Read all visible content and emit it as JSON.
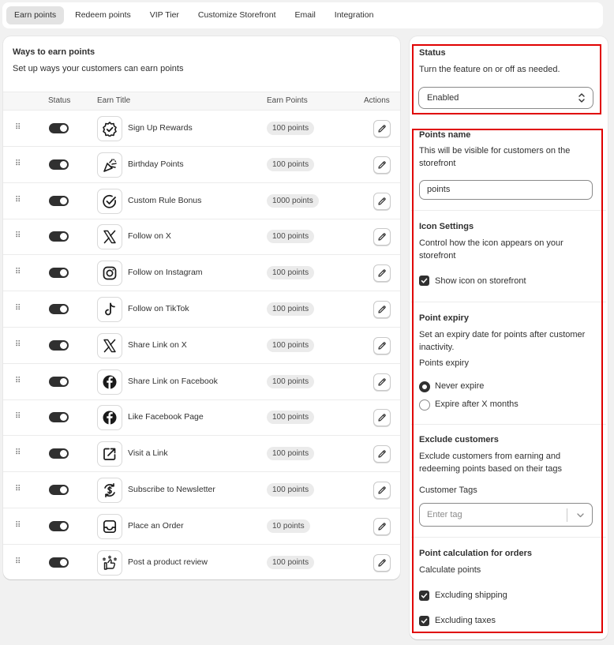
{
  "tabs": [
    {
      "label": "Earn points",
      "active": true
    },
    {
      "label": "Redeem points",
      "active": false
    },
    {
      "label": "VIP Tier",
      "active": false
    },
    {
      "label": "Customize Storefront",
      "active": false
    },
    {
      "label": "Email",
      "active": false
    },
    {
      "label": "Integration",
      "active": false
    }
  ],
  "earn": {
    "title": "Ways to earn points",
    "subtitle": "Set up ways your customers can earn points",
    "columns": {
      "status": "Status",
      "title": "Earn Title",
      "points": "Earn Points",
      "actions": "Actions"
    },
    "rows": [
      {
        "title": "Sign Up Rewards",
        "points": "100 points",
        "icon": "badge-check-icon",
        "enabled": true
      },
      {
        "title": "Birthday Points",
        "points": "100 points",
        "icon": "party-popper-icon",
        "enabled": true
      },
      {
        "title": "Custom Rule Bonus",
        "points": "1000 points",
        "icon": "check-circle-icon",
        "enabled": true
      },
      {
        "title": "Follow on X",
        "points": "100 points",
        "icon": "x-logo-icon",
        "enabled": true
      },
      {
        "title": "Follow on Instagram",
        "points": "100 points",
        "icon": "instagram-icon",
        "enabled": true
      },
      {
        "title": "Follow on TikTok",
        "points": "100 points",
        "icon": "tiktok-icon",
        "enabled": true
      },
      {
        "title": "Share Link on X",
        "points": "100 points",
        "icon": "x-logo-icon",
        "enabled": true
      },
      {
        "title": "Share Link on Facebook",
        "points": "100 points",
        "icon": "facebook-icon",
        "enabled": true
      },
      {
        "title": "Like Facebook Page",
        "points": "100 points",
        "icon": "facebook-icon",
        "enabled": true
      },
      {
        "title": "Visit a Link",
        "points": "100 points",
        "icon": "external-link-icon",
        "enabled": true
      },
      {
        "title": "Subscribe to Newsletter",
        "points": "100 points",
        "icon": "dollar-cycle-icon",
        "enabled": true
      },
      {
        "title": "Place an Order",
        "points": "10 points",
        "icon": "inbox-tray-icon",
        "enabled": true
      },
      {
        "title": "Post a product review",
        "points": "100 points",
        "icon": "review-thumb-icon",
        "enabled": true
      }
    ]
  },
  "settings": {
    "status": {
      "title": "Status",
      "description": "Turn the feature on or off as needed.",
      "value": "Enabled"
    },
    "points_name": {
      "title": "Points name",
      "description": "This will be visible for customers on the storefront",
      "value": "points"
    },
    "icon_settings": {
      "title": "Icon Settings",
      "description": "Control how the icon appears on your storefront",
      "checkbox_label": "Show icon on storefront",
      "checked": true
    },
    "point_expiry": {
      "title": "Point expiry",
      "description": "Set an expiry date for points after customer inactivity.",
      "field_label": "Points expiry",
      "options": [
        {
          "label": "Never expire",
          "selected": true
        },
        {
          "label": "Expire after X months",
          "selected": false
        }
      ]
    },
    "exclude_customers": {
      "title": "Exclude customers",
      "description": "Exclude customers from earning and redeeming points based on their tags",
      "field_label": "Customer Tags",
      "placeholder": "Enter tag"
    },
    "point_calculation": {
      "title": "Point calculation for orders",
      "subtitle": "Calculate points",
      "options": [
        {
          "label": "Excluding shipping",
          "checked": true
        },
        {
          "label": "Excluding taxes",
          "checked": true
        }
      ]
    }
  },
  "colors": {
    "highlight": "#e00000",
    "toggle_on": "#303030",
    "page_bg": "#f1f1f1"
  }
}
